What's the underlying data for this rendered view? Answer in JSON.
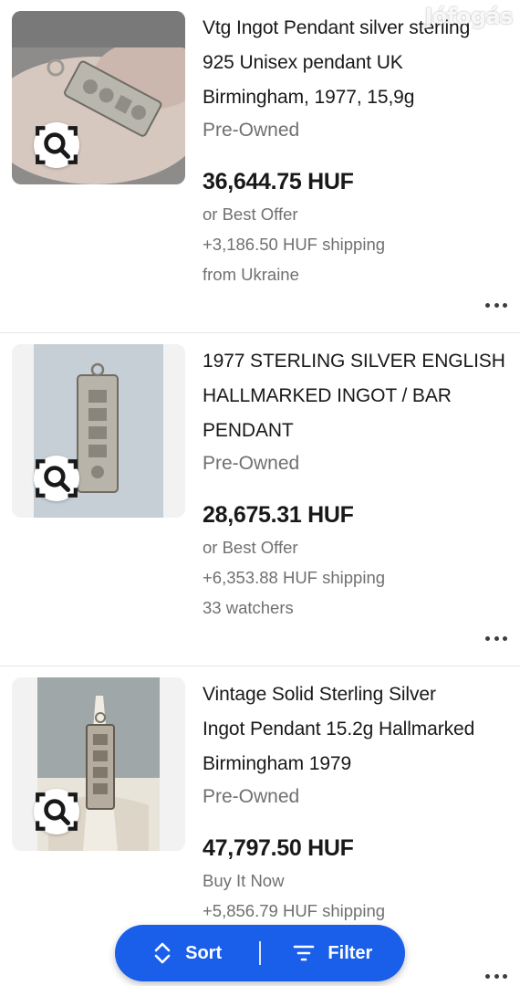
{
  "watermark": "Jófogás",
  "listings": [
    {
      "title_lines": [
        "Vtg Ingot Pendant silver sterling",
        "925 Unisex pendant UK",
        "Birmingham, 1977, 15,9g"
      ],
      "condition": "Pre-Owned",
      "price": "36,644.75 HUF",
      "meta": [
        "or Best Offer",
        "+3,186.50 HUF shipping",
        "from Ukraine"
      ]
    },
    {
      "title_lines": [
        "1977 STERLING SILVER ENGLISH",
        "HALLMARKED INGOT / BAR",
        "PENDANT"
      ],
      "condition": "Pre-Owned",
      "price": "28,675.31 HUF",
      "meta": [
        "or Best Offer",
        "+6,353.88 HUF shipping",
        "33 watchers"
      ]
    },
    {
      "title_lines": [
        "Vintage Solid Sterling Silver",
        "Ingot Pendant 15.2g Hallmarked",
        "Birmingham 1979"
      ],
      "condition": "Pre-Owned",
      "price": "47,797.50 HUF",
      "meta": [
        "Buy It Now",
        "+5,856.79 HUF shipping"
      ]
    }
  ],
  "fab": {
    "sort_label": "Sort",
    "filter_label": "Filter"
  },
  "colors": {
    "accent": "#1a5fea",
    "text": "#191919",
    "muted": "#707070"
  }
}
